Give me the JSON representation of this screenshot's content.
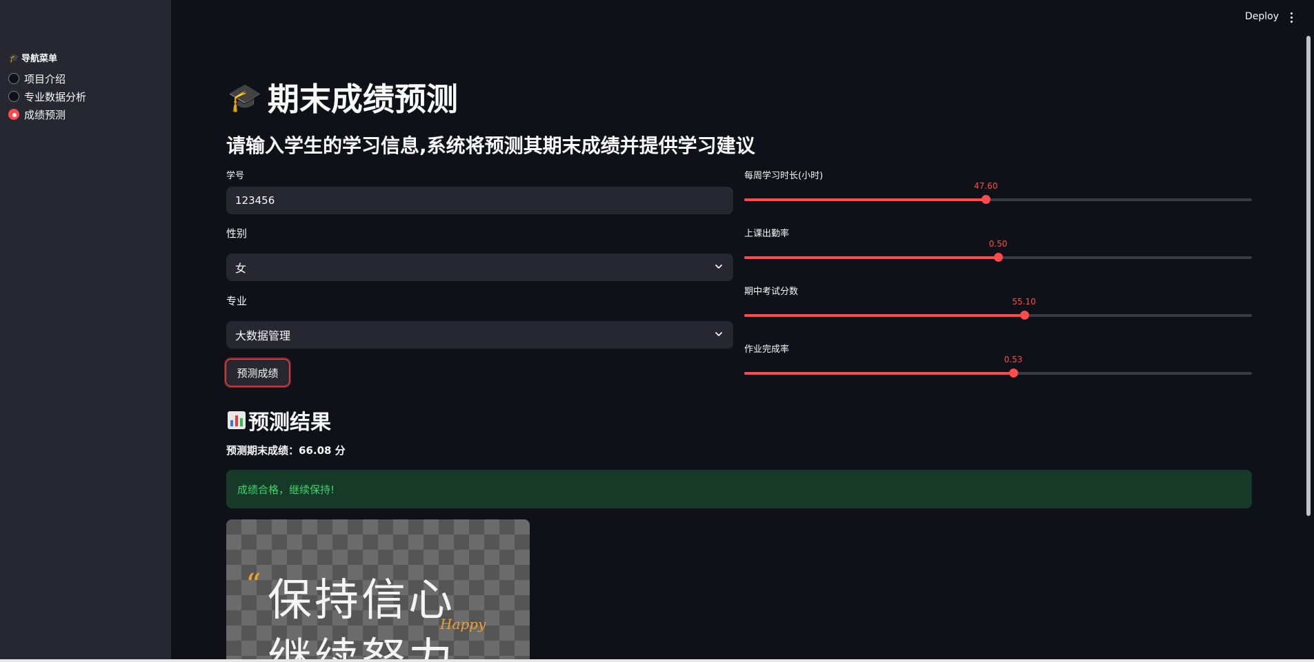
{
  "sidebar": {
    "title_icon": "graduation-cap-icon",
    "title": "导航菜单",
    "items": [
      {
        "label": "项目介绍",
        "selected": false
      },
      {
        "label": "专业数据分析",
        "selected": false
      },
      {
        "label": "成绩预测",
        "selected": true
      }
    ]
  },
  "header": {
    "deploy_label": "Deploy",
    "menu_icon": "more-vertical-icon"
  },
  "main": {
    "title_icon": "graduation-cap-icon",
    "title": "期末成绩预测",
    "subtitle": "请输入学生的学习信息,系统将预测其期末成绩并提供学习建议",
    "form": {
      "student_id_label": "学号",
      "student_id_value": "123456",
      "gender_label": "性别",
      "gender_value": "女",
      "major_label": "专业",
      "major_value": "大数据管理",
      "submit_label": "预测成绩"
    },
    "sliders": [
      {
        "label": "每周学习时长(小时)",
        "value": "47.60",
        "fraction": 0.476
      },
      {
        "label": "上课出勤率",
        "value": "0.50",
        "fraction": 0.5
      },
      {
        "label": "期中考试分数",
        "value": "55.10",
        "fraction": 0.551
      },
      {
        "label": "作业完成率",
        "value": "0.53",
        "fraction": 0.53
      }
    ],
    "result": {
      "title_icon": "bar-chart-icon",
      "title": "预测结果",
      "score_text": "预测期末成绩：66.08 分",
      "message": "成绩合格，继续保持!"
    },
    "image": {
      "line1": "保持信心",
      "line2": "继续努力",
      "quote": "“",
      "decor": "Happy"
    }
  },
  "colors": {
    "accent": "#ff4b4b",
    "background": "#0e1117",
    "sidebar": "#262730",
    "success_bg": "#173928",
    "success_text": "#3dd56d"
  }
}
